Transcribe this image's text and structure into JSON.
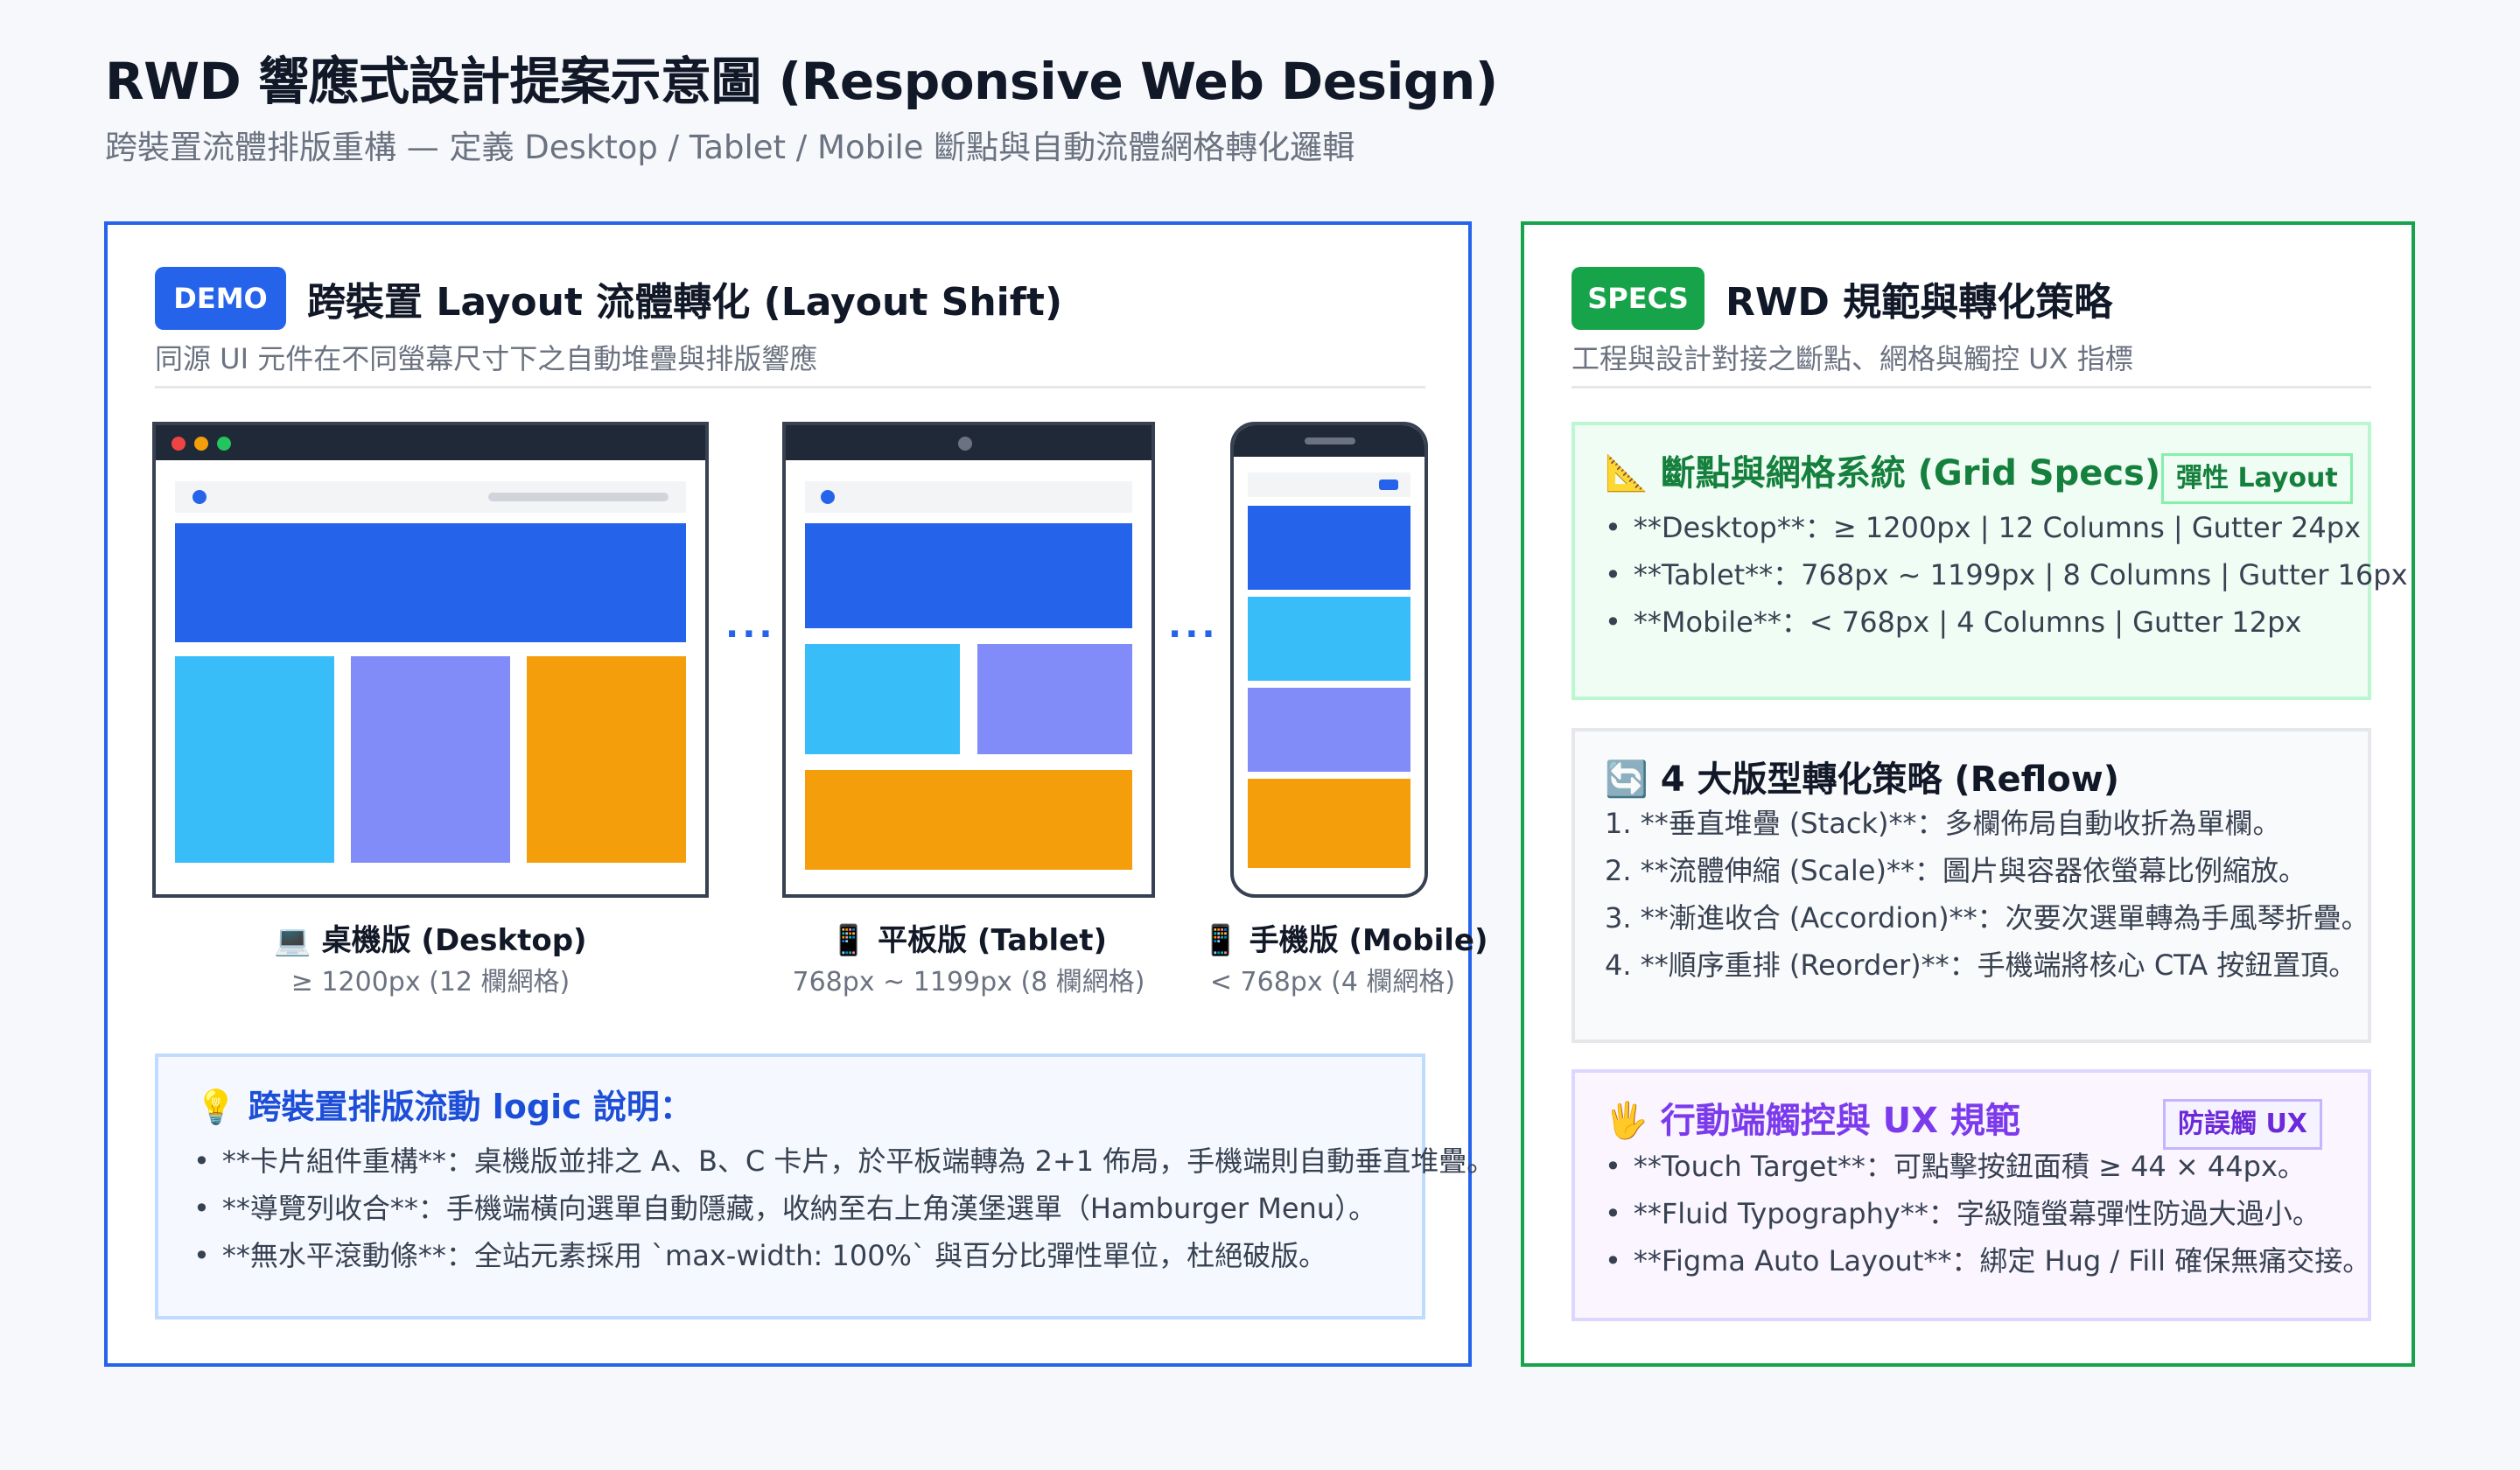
{
  "title": "RWD 響應式設計提案示意圖 (Responsive Web Design)",
  "subtitle": "跨裝置流體排版重構 — 定義 Desktop / Tablet / Mobile 斷點與自動流體網格轉化邏輯",
  "demo": {
    "tag": "DEMO",
    "heading": "跨裝置 Layout 流體轉化 (Layout Shift)",
    "sub": "同源 UI 元件在不同螢幕尺寸下之自動堆疊與排版響應",
    "ellipsis": "···",
    "devices": {
      "desktop": {
        "label": "💻 桌機版 (Desktop)",
        "spec": "≥ 1200px (12 欄網格)"
      },
      "tablet": {
        "label": "📱 平板版 (Tablet)",
        "spec": "768px ~ 1199px (8 欄網格)"
      },
      "mobile": {
        "label": "📱 手機版 (Mobile)",
        "spec": "< 768px (4 欄網格)"
      }
    },
    "logic": {
      "title": "💡 跨裝置排版流動 logic 說明：",
      "items": [
        "**卡片組件重構**：桌機版並排之 A、B、C 卡片，於平板端轉為 2+1 佈局，手機端則自動垂直堆疊。",
        "**導覽列收合**：手機端橫向選單自動隱藏，收納至右上角漢堡選單（Hamburger Menu）。",
        "**無水平滾動條**：全站元素採用 `max-width: 100%` 與百分比彈性單位，杜絕破版。"
      ]
    }
  },
  "specs": {
    "tag": "SPECS",
    "heading": "RWD 規範與轉化策略",
    "sub": "工程與設計對接之斷點、網格與觸控 UX 指標",
    "grid_card": {
      "title": "📐 斷點與網格系統 (Grid Specs)",
      "badge": "彈性 Layout",
      "items": [
        "**Desktop**：≥ 1200px | 12 Columns | Gutter 24px",
        "**Tablet**：768px ~ 1199px | 8 Columns | Gutter 16px",
        "**Mobile**：< 768px | 4 Columns | Gutter 12px"
      ]
    },
    "reflow_card": {
      "title": "🔄 4 大版型轉化策略 (Reflow)",
      "items": [
        "1. **垂直堆疊 (Stack)**：多欄佈局自動收折為單欄。",
        "2. **流體伸縮 (Scale)**：圖片與容器依螢幕比例縮放。",
        "3. **漸進收合 (Accordion)**：次要次選單轉為手風琴折疊。",
        "4. **順序重排 (Reorder)**：手機端將核心 CTA 按鈕置頂。"
      ]
    },
    "touch_card": {
      "title": "🖐 行動端觸控與 UX 規範",
      "badge": "防誤觸 UX",
      "items": [
        "**Touch Target**：可點擊按鈕面積 ≥ 44 × 44px。",
        "**Fluid Typography**：字級隨螢幕彈性防過大過小。",
        "**Figma Auto Layout**：綁定 Hug / Fill 確保無痛交接。"
      ]
    }
  },
  "colors": {
    "primary_blue": "#2563eb",
    "accent_cyan": "#38bdf8",
    "accent_indigo": "#818cf8",
    "accent_amber": "#f59e0b",
    "specs_green": "#16a34a",
    "touch_purple": "#7c3aed"
  }
}
